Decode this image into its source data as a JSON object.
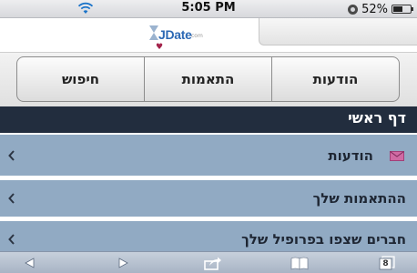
{
  "status_bar": {
    "time": "5:05 PM",
    "battery": "52%",
    "battery_level": 0.52
  },
  "header": {
    "logo_text": "JDate",
    "logo_tm": "com"
  },
  "nav": {
    "buttons": [
      {
        "label": "חיפוש"
      },
      {
        "label": "התאמות"
      },
      {
        "label": "הודעות"
      }
    ]
  },
  "page": {
    "title": "דף ראשי"
  },
  "list": {
    "items": [
      {
        "label": "הודעות",
        "icon": "envelope-icon"
      },
      {
        "label": "ההתאמות שלך"
      },
      {
        "label": "חברים שצפו בפרופיל שלך"
      }
    ]
  },
  "toolbar": {
    "tabs_count": "8"
  },
  "colors": {
    "title_bar": "#222d3e",
    "list_row": "#91aac3",
    "logo_blue": "#2c69b5",
    "heart": "#a3234b"
  }
}
